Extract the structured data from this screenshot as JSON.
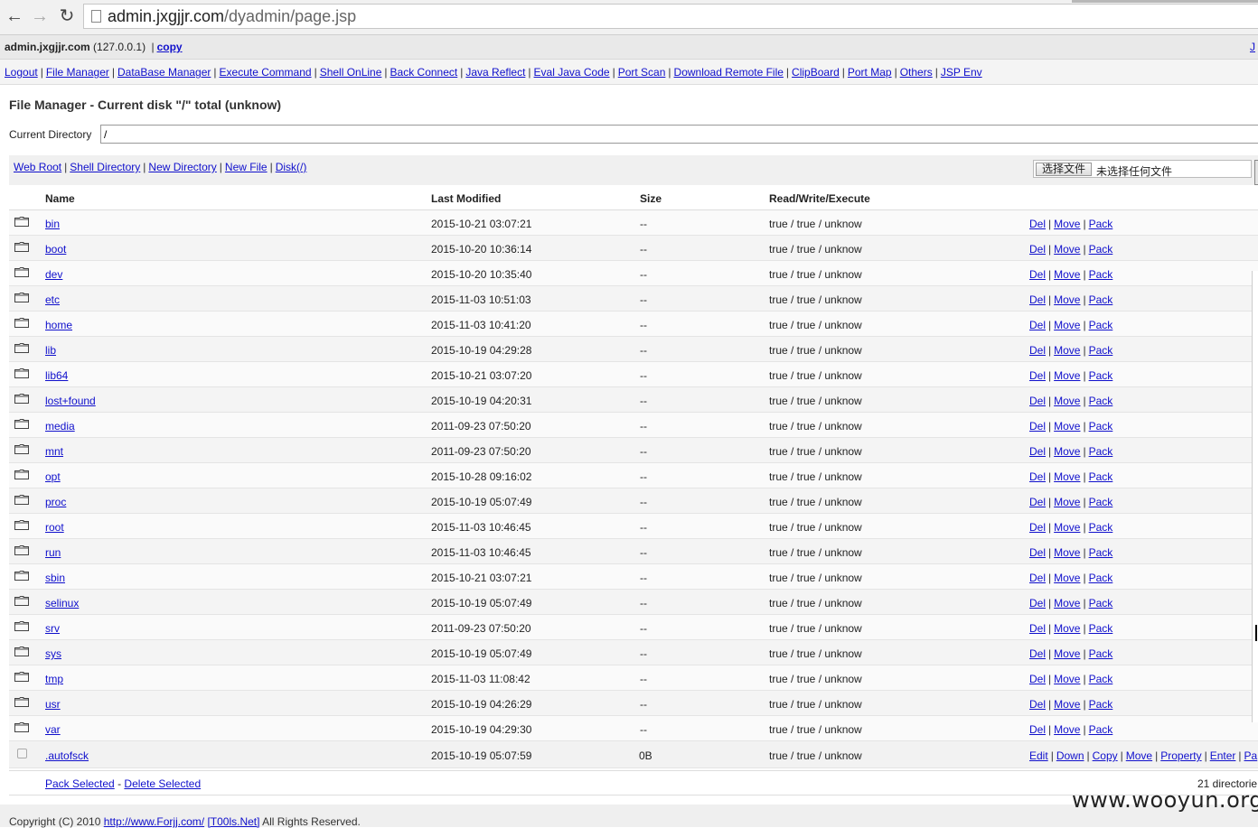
{
  "browser": {
    "url_host": "admin.jxgjjr.com",
    "url_path": "/dyadmin/page.jsp"
  },
  "hostbar": {
    "host": "admin.jxgjjr.com",
    "ip": "(127.0.0.1)",
    "copy_label": "copy",
    "right_text": "J"
  },
  "menu": [
    "Logout",
    "File Manager",
    "DataBase Manager",
    "Execute Command",
    "Shell OnLine",
    "Back Connect",
    "Java Reflect",
    "Eval Java Code",
    "Port Scan",
    "Download Remote File",
    "ClipBoard",
    "Port Map",
    "Others",
    "JSP Env"
  ],
  "section": {
    "title": "File Manager - Current disk \"/\" total (unknow)",
    "current_dir_label": "Current Directory",
    "current_dir_value": "/"
  },
  "quicklinks": [
    "Web Root",
    "Shell Directory",
    "New Directory",
    "New File",
    "Disk(/)"
  ],
  "upload": {
    "button_label": "选择文件",
    "no_file_text": "未选择任何文件"
  },
  "table": {
    "headers": [
      "Name",
      "Last Modified",
      "Size",
      "Read/Write/Execute"
    ],
    "dir_actions": [
      "Del",
      "Move",
      "Pack"
    ],
    "directories": [
      {
        "name": "bin",
        "modified": "2015-10-21 03:07:21",
        "size": "--",
        "rwx": "true / true / unknow"
      },
      {
        "name": "boot",
        "modified": "2015-10-20 10:36:14",
        "size": "--",
        "rwx": "true / true / unknow"
      },
      {
        "name": "dev",
        "modified": "2015-10-20 10:35:40",
        "size": "--",
        "rwx": "true / true / unknow"
      },
      {
        "name": "etc",
        "modified": "2015-11-03 10:51:03",
        "size": "--",
        "rwx": "true / true / unknow"
      },
      {
        "name": "home",
        "modified": "2015-11-03 10:41:20",
        "size": "--",
        "rwx": "true / true / unknow"
      },
      {
        "name": "lib",
        "modified": "2015-10-19 04:29:28",
        "size": "--",
        "rwx": "true / true / unknow"
      },
      {
        "name": "lib64",
        "modified": "2015-10-21 03:07:20",
        "size": "--",
        "rwx": "true / true / unknow"
      },
      {
        "name": "lost+found",
        "modified": "2015-10-19 04:20:31",
        "size": "--",
        "rwx": "true / true / unknow"
      },
      {
        "name": "media",
        "modified": "2011-09-23 07:50:20",
        "size": "--",
        "rwx": "true / true / unknow"
      },
      {
        "name": "mnt",
        "modified": "2011-09-23 07:50:20",
        "size": "--",
        "rwx": "true / true / unknow"
      },
      {
        "name": "opt",
        "modified": "2015-10-28 09:16:02",
        "size": "--",
        "rwx": "true / true / unknow"
      },
      {
        "name": "proc",
        "modified": "2015-10-19 05:07:49",
        "size": "--",
        "rwx": "true / true / unknow"
      },
      {
        "name": "root",
        "modified": "2015-11-03 10:46:45",
        "size": "--",
        "rwx": "true / true / unknow"
      },
      {
        "name": "run",
        "modified": "2015-11-03 10:46:45",
        "size": "--",
        "rwx": "true / true / unknow"
      },
      {
        "name": "sbin",
        "modified": "2015-10-21 03:07:21",
        "size": "--",
        "rwx": "true / true / unknow"
      },
      {
        "name": "selinux",
        "modified": "2015-10-19 05:07:49",
        "size": "--",
        "rwx": "true / true / unknow"
      },
      {
        "name": "srv",
        "modified": "2011-09-23 07:50:20",
        "size": "--",
        "rwx": "true / true / unknow"
      },
      {
        "name": "sys",
        "modified": "2015-10-19 05:07:49",
        "size": "--",
        "rwx": "true / true / unknow"
      },
      {
        "name": "tmp",
        "modified": "2015-11-03 11:08:42",
        "size": "--",
        "rwx": "true / true / unknow"
      },
      {
        "name": "usr",
        "modified": "2015-10-19 04:26:29",
        "size": "--",
        "rwx": "true / true / unknow"
      },
      {
        "name": "var",
        "modified": "2015-10-19 04:29:30",
        "size": "--",
        "rwx": "true / true / unknow"
      }
    ],
    "file": {
      "name": ".autofsck",
      "modified": "2015-10-19 05:07:59",
      "size": "0B",
      "rwx": "true / true / unknow",
      "actions": [
        "Edit",
        "Down",
        "Copy",
        "Move",
        "Property",
        "Enter",
        "Pa"
      ]
    }
  },
  "footer": {
    "pack_selected": "Pack Selected",
    "dash": "-",
    "delete_selected": "Delete Selected",
    "count_text": "21 directorie"
  },
  "copyright": {
    "prefix": "Copyright (C) 2010",
    "link1": "http://www.Forjj.com/",
    "link2": "[T00ls.Net]",
    "suffix": "All Rights Reserved."
  },
  "watermark": "www.wooyun.org"
}
